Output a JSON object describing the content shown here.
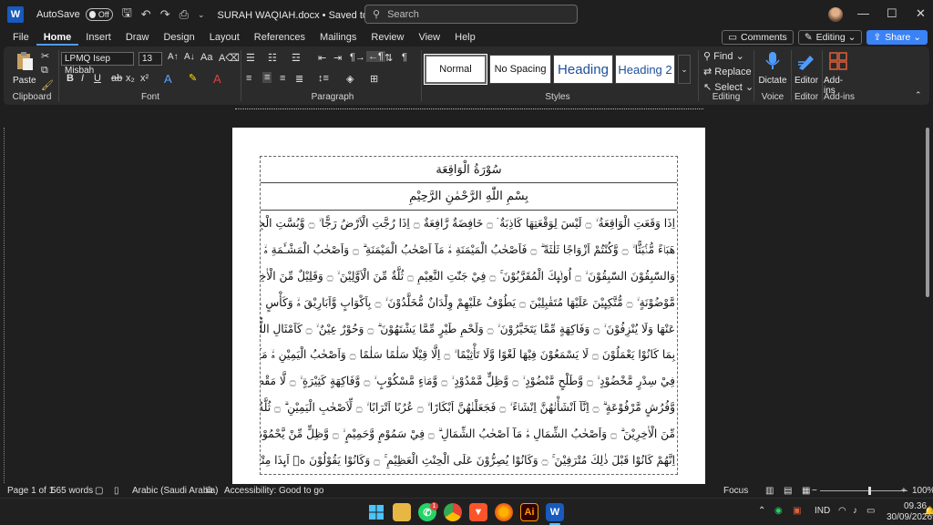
{
  "titlebar": {
    "app_logo": "W",
    "autosave_label": "AutoSave",
    "autosave_state": "Off",
    "doc_title": "SURAH WAQIAH.docx • Saved to this PC ⌄",
    "search_placeholder": "Search",
    "minimize": "—",
    "maximize": "☐",
    "close": "✕"
  },
  "menu": {
    "items": [
      "File",
      "Home",
      "Insert",
      "Draw",
      "Design",
      "Layout",
      "References",
      "Mailings",
      "Review",
      "View",
      "Help"
    ],
    "comments": "Comments",
    "editing": "Editing ⌄",
    "share": "Share ⌄"
  },
  "ribbon": {
    "clipboard": {
      "paste": "Paste",
      "label": "Clipboard"
    },
    "font": {
      "name": "LPMQ Isep Misbah",
      "size": "13",
      "label": "Font"
    },
    "paragraph": {
      "label": "Paragraph"
    },
    "styles": {
      "label": "Styles",
      "items": [
        "Normal",
        "No Spacing",
        "Heading",
        "Heading 2"
      ]
    },
    "editing": {
      "find": "Find",
      "replace": "Replace",
      "select": "Select",
      "label": "Editing"
    },
    "voice": {
      "dictate": "Dictate",
      "label": "Voice"
    },
    "editor": {
      "editor": "Editor",
      "label": "Editor"
    },
    "addins": {
      "addins": "Add-ins",
      "label": "Add-ins"
    }
  },
  "document": {
    "title": "سُوْرَةُ الْوَاقِعَة",
    "bismillah": "بِسْمِ اللّٰهِ الرَّحْمٰنِ الرَّحِيْمِ",
    "lines": [
      "اِذَا وَقَعَتِ الْوَاقِعَةُ ۙ ۝ لَيْسَ لِوَقْعَتِهَا كَاذِبَةٌ ۘ ۝ خَافِضَةٌ رَّافِعَةٌ ۝ اِذَا رُجَّتِ الْاَرْضُ رَجًّا ۙ ۝ وَّبُسَّتِ الْجِبَالُ بَسًّا ۙ ۝ فَكَانَتْ",
      "هَبَاۤءً مُّنْۢبَثًّا ۙ ۝ وَّكُنْتُمْ اَزْوَاجًا ثَلٰثَةً ۗ ۝ فَاَصْحٰبُ الْمَيْمَنَةِ ەۙ مَآ اَصْحٰبُ الْمَيْمَنَةِ ۗ ۝ وَاَصْحٰبُ الْمَشْـَٔمَةِ ەۙ مَآ اَصْحٰبُ الْمَشْـَٔمَةِ ۗ",
      "وَالسّٰبِقُوْنَ السّٰبِقُوْنَ ۙ ۝ اُولٰۤىِٕكَ الْمُقَرَّبُوْنَ ۚ ۝ فِيْ جَنّٰتِ النَّعِيْمِ ۝ ثُلَّةٌ مِّنَ الْاَوَّلِيْنَ ۙ ۝ وَقَلِيْلٌ مِّنَ الْاٰخِرِيْنَ ۗ ۝ عَلٰى سُرُرٍ",
      "مَّوْضُوْنَةٍ ۙ ۝ مُّتَّكِىِٕيْنَ عَلَيْهَا مُتَقٰبِلِيْنَ ۝ يَطُوْفُ عَلَيْهِمْ وِلْدَانٌ مُّخَلَّدُوْنَ ۙ ۝ بِاَكْوَابٍ وَّاَبَارِيْقَ ەۙ وَكَأْسٍ مِّنْ مَّعِيْنٍ ۙ ۝ لَّا يُصَدَّعُوْنَ",
      "عَنْهَا وَلَا يُنْزِفُوْنَ ۙ ۝ وَفَاكِهَةٍ مِّمَّا يَتَخَيَّرُوْنَ ۙ ۝ وَلَحْمِ طَيْرٍ مِّمَّا يَشْتَهُوْنَ ۗ ۝ وَحُوْرٌ عِيْنٌ ۙ ۝ كَاَمْثَالِ اللُّؤْلُؤِ الْمَكْنُوْنِ ۚ ۝ جَزَاۤءً",
      "بِمَا كَانُوْا يَعْمَلُوْنَ ۝ لَا يَسْمَعُوْنَ فِيْهَا لَغْوًا وَّلَا تَأْثِيْمًا ۙ ۝ اِلَّا قِيْلًا سَلٰمًا سَلٰمًا ۝ وَاَصْحٰبُ الْيَمِيْنِ ەۙ مَآ اَصْحٰبُ الْيَمِيْنِ ۗ",
      "فِيْ سِدْرٍ مَّخْضُوْدٍ ۙ ۝ وَّطَلْحٍ مَّنْضُوْدٍ ۙ ۝ وَّظِلٍّ مَّمْدُوْدٍ ۙ ۝ وَّمَاۤءٍ مَّسْكُوْبٍ ۙ ۝ وَّفَاكِهَةٍ كَثِيْرَةٍ ۙ ۝ لَّا مَقْطُوْعَةٍ وَّلَا مَمْنُوْعَةٍ",
      "وَّفُرُشٍ مَّرْفُوْعَةٍ ۗ ۝ اِنَّآ اَنْشَأْنٰهُنَّ اِنْشَاۤءً ۙ ۝ فَجَعَلْنٰهُنَّ اَبْكَارًا ۙ ۝ عُرُبًا اَتْرَابًا ۙ ۝ لِّاَصْحٰبِ الْيَمِيْنِ ۗ ۝ ثُلَّةٌ مِّنَ الْاَوَّلِيْنَ ۙ ۝ وَثُلَّةٌ",
      "مِّنَ الْاٰخِرِيْنَ ۗ ۝ وَاَصْحٰبُ الشِّمَالِ ەۙ مَآ اَصْحٰبُ الشِّمَالِ ۗ ۝ فِيْ سَمُوْمٍ وَّحَمِيْمٍ ۙ ۝ وَّظِلٍّ مِّنْ يَّحْمُوْمٍ ۙ ۝ لَّا بَارِدٍ وَّلَا كَرِيْمٍ",
      "اِنَّهُمْ كَانُوْا قَبْلَ ذٰلِكَ مُتْرَفِيْنَ ۚ ۝ وَكَانُوْا يُصِرُّوْنَ عَلَى الْحِنْثِ الْعَظِيْمِ ۚ ۝ وَكَانُوْا يَقُوْلُوْنَ ەۙ اَىِٕذَا مِتْنَا وَكُنَّا تُرَابًا وَّعِظَامًا ءَاِنَّا"
    ]
  },
  "status": {
    "page": "Page 1 of 1",
    "words": "565 words",
    "language": "Arabic (Saudi Arabia)",
    "accessibility": "Accessibility: Good to go",
    "focus": "Focus",
    "zoom": "100%"
  },
  "taskbar": {
    "lang": "IND",
    "time": "09.36",
    "date": "30/09/2026",
    "whatsapp_badge": "1"
  }
}
